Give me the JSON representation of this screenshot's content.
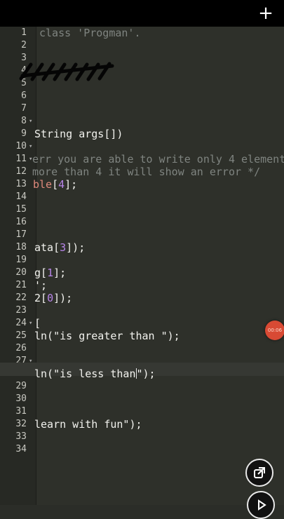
{
  "toolbar": {
    "add_icon": "plus-icon",
    "add_label": "+"
  },
  "line_numbers": [
    "1",
    "2",
    "3",
    "4",
    "5",
    "6",
    "7",
    "8",
    "9",
    "10",
    "11",
    "12",
    "13",
    "14",
    "15",
    "16",
    "17",
    "18",
    "19",
    "20",
    "21",
    "22",
    "23",
    "24",
    "25",
    "26",
    "27",
    "28",
    "29",
    "30",
    "31",
    "32",
    "33",
    "34"
  ],
  "code": {
    "l1": "class 'Progman'.",
    "l9": "String args[])",
    "l11": "err you are able to write only 4 elements",
    "l12": "more than 4 it will show an error */",
    "l13_a": "ble",
    "l13_b": "[",
    "l13_c": "4",
    "l13_d": "];",
    "l18_a": "ata[",
    "l18_b": "3",
    "l18_c": "]);",
    "l20_a": "g[",
    "l20_b": "1",
    "l20_c": "];",
    "l21": "';",
    "l22_a": "2[",
    "l22_b": "0",
    "l22_c": "]);",
    "l24": "[",
    "l25": "ln(\"is greater than \");",
    "l28_a": "ln(\"is less than",
    "l28_b": "\");",
    "l32": "learn with fun\");"
  },
  "overlay": {
    "record_time": "00:06",
    "record_color": "#d84a34",
    "scroll_button_icon": "scroll-sync-icon",
    "play_button_icon": "play-icon"
  }
}
